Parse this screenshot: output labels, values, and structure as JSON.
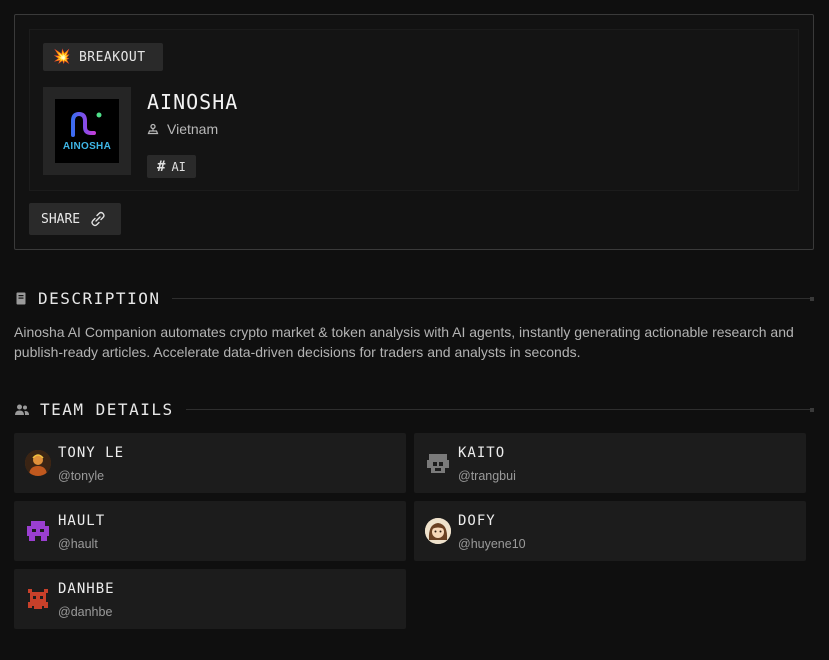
{
  "project": {
    "badge": "BREAKOUT",
    "badge_icon": "collision-emoji",
    "logo_text": "AINOSHA",
    "name": "AINOSHA",
    "location": "Vietnam",
    "tag": "AI",
    "share_label": "SHARE"
  },
  "description": {
    "title": "DESCRIPTION",
    "text": "Ainosha AI Companion automates crypto market & token analysis with AI agents, instantly generating actionable research and publish-ready articles. Accelerate data-driven decisions for traders and analysts in seconds."
  },
  "team": {
    "title": "TEAM DETAILS",
    "members": [
      {
        "name": "TONY LE",
        "handle": "@tonyle"
      },
      {
        "name": "KAITO",
        "handle": "@trangbui"
      },
      {
        "name": "HAULT",
        "handle": "@hault"
      },
      {
        "name": "DOFY",
        "handle": "@huyene10"
      },
      {
        "name": "DANHBE",
        "handle": "@danhbe"
      }
    ]
  },
  "colors": {
    "background": "#0f0f0f",
    "card": "#1c1c1c",
    "logo_gradient_start": "#3b6cf0",
    "logo_gradient_end": "#b23be6"
  }
}
